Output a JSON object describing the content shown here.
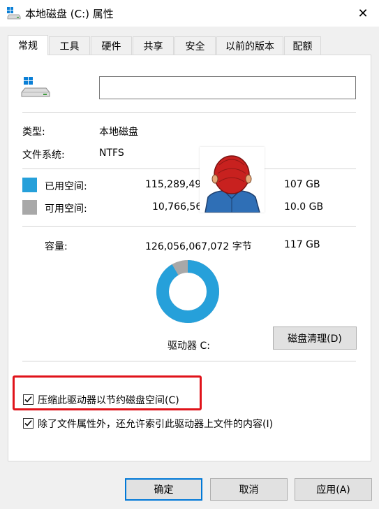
{
  "window": {
    "title": "本地磁盘 (C:) 属性",
    "close_glyph": "✕"
  },
  "tabs": [
    {
      "label": "常规",
      "active": true
    },
    {
      "label": "工具"
    },
    {
      "label": "硬件"
    },
    {
      "label": "共享"
    },
    {
      "label": "安全"
    },
    {
      "label": "以前的版本"
    },
    {
      "label": "配额"
    }
  ],
  "general": {
    "drive_name_value": "",
    "type_label": "类型:",
    "type_value": "本地磁盘",
    "fs_label": "文件系统:",
    "fs_value": "NTFS",
    "used_label": "已用空间:",
    "used_bytes": "115,289,497,6",
    "used_gb": "107 GB",
    "free_label": "可用空间:",
    "free_bytes": "10,766,569",
    "free_gb": "10.0 GB",
    "capacity_label": "容量:",
    "capacity_bytes": "126,056,067,072 字节",
    "capacity_gb": "117 GB",
    "drive_label": "驱动器 C:",
    "cleanup_button": "磁盘清理(D)",
    "used_fraction": 0.915,
    "used_color": "#26a0da",
    "free_color": "#a8a8a8"
  },
  "options": {
    "compress_label": "压缩此驱动器以节约磁盘空间(C)",
    "compress_checked": true,
    "index_label": "除了文件属性外，还允许索引此驱动器上文件的内容(I)",
    "index_checked": true
  },
  "buttons": {
    "ok": "确定",
    "cancel": "取消",
    "apply": "应用(A)"
  }
}
